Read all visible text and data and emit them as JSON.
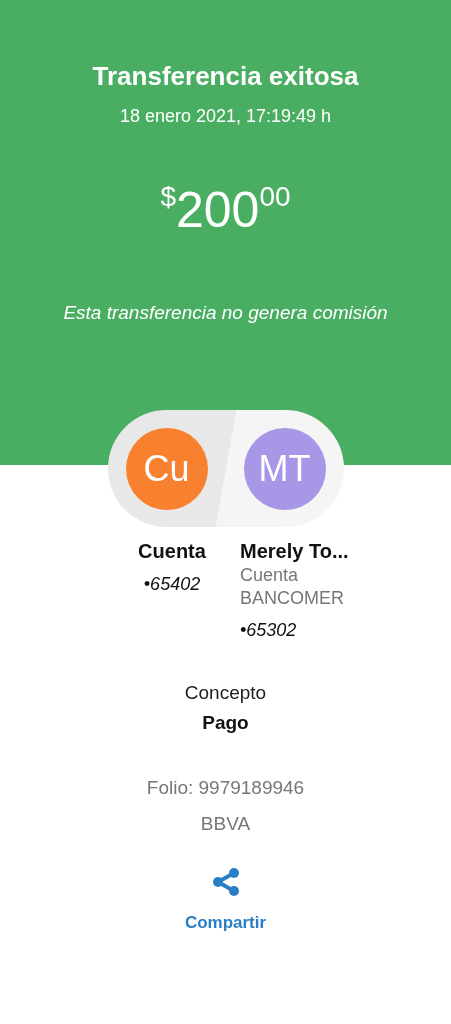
{
  "header": {
    "title": "Transferencia exitosa",
    "datetime": "18 enero 2021, 17:19:49 h",
    "amount": {
      "currency": "$",
      "whole": "200",
      "cents": "00"
    },
    "note": "Esta transferencia no genera comisión"
  },
  "parties": [
    {
      "initials": "Cu",
      "color": "#f7812f",
      "name": "Cuenta",
      "account": "•65402"
    },
    {
      "initials": "MT",
      "color": "#a897e6",
      "name": "Merely To...",
      "lines": [
        "Cuenta",
        "BANCOMER"
      ],
      "account": "•65302"
    }
  ],
  "concept": {
    "label": "Concepto",
    "value": "Pago"
  },
  "folio": "Folio: 9979189946",
  "bank": "BBVA",
  "share": {
    "label": "Compartir"
  }
}
